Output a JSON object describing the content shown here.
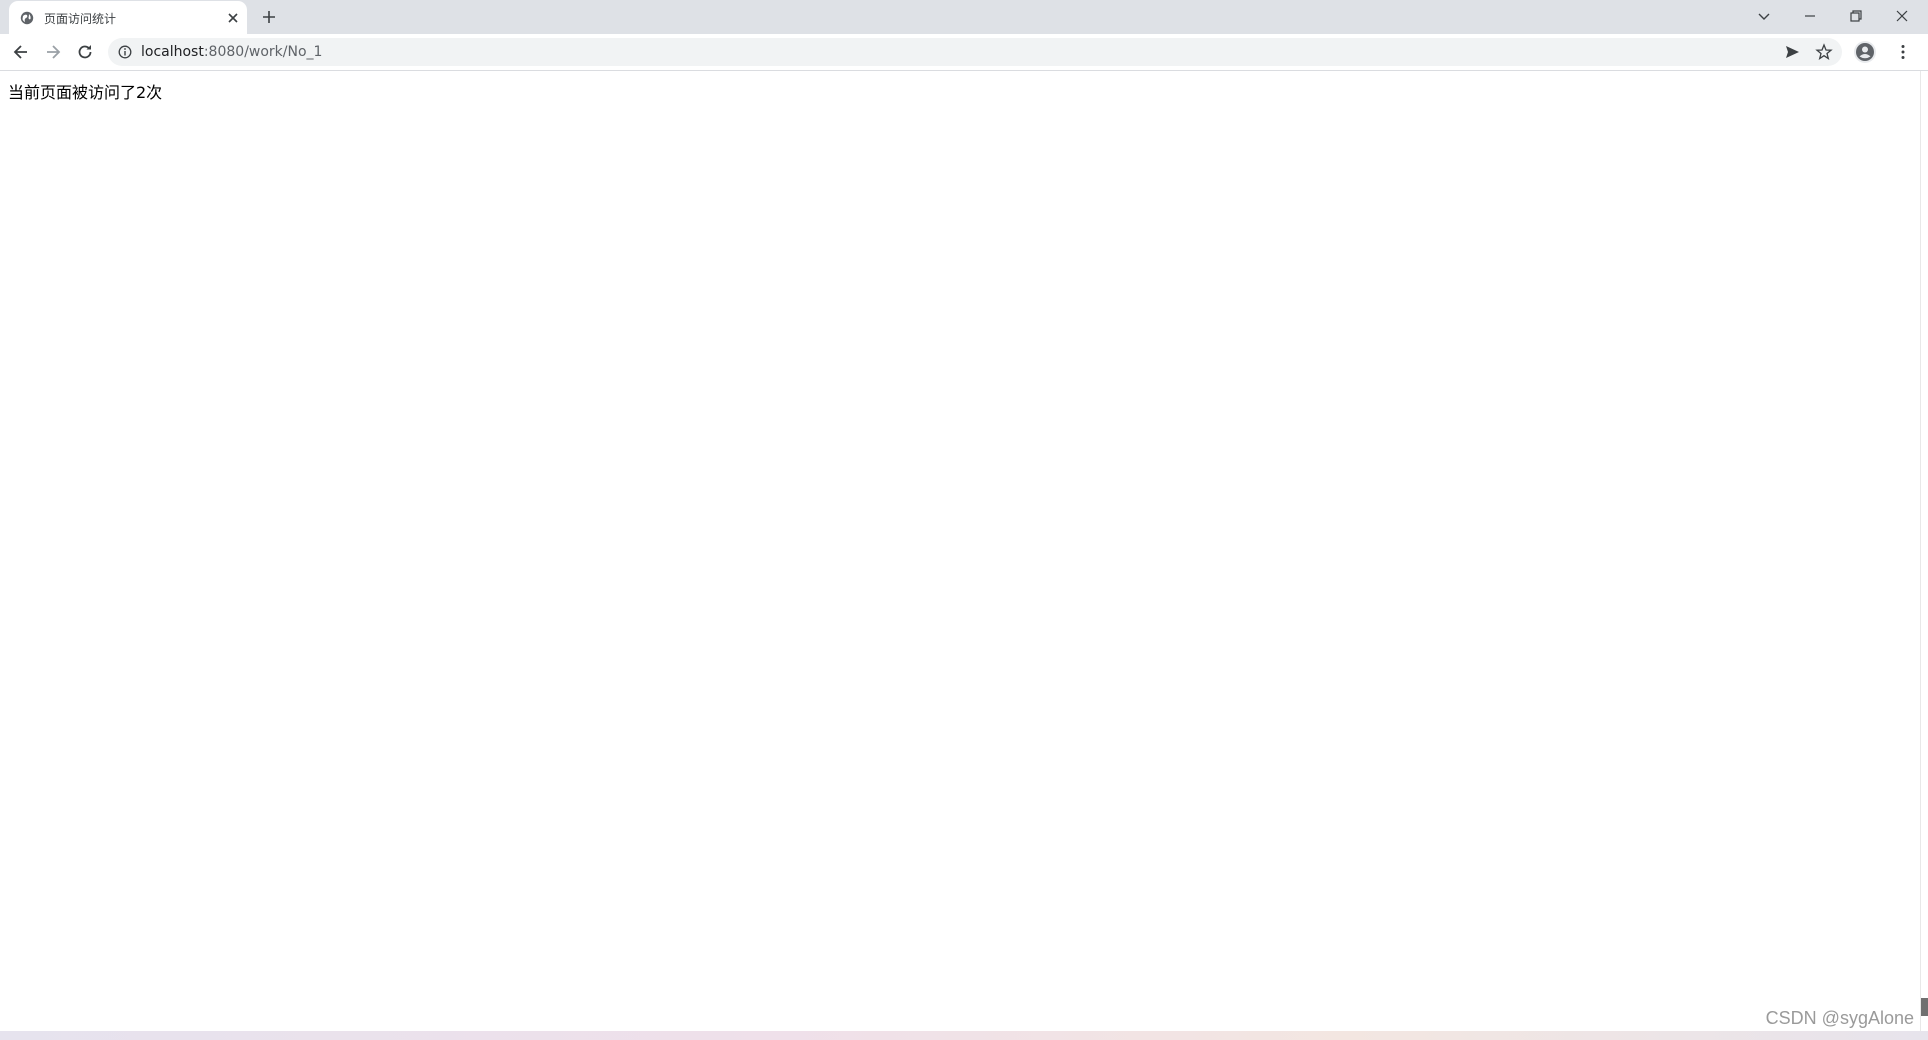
{
  "tab": {
    "title": "页面访问统计",
    "favicon": "globe-icon"
  },
  "address_bar": {
    "url_host": "localhost",
    "url_rest": ":8080/work/No_1"
  },
  "page": {
    "message": "当前页面被访问了2次"
  },
  "watermark": "CSDN @sygAlone",
  "colors": {
    "tabstrip": "#dee1e6",
    "omnibox": "#f1f3f4",
    "icon": "#5f6368"
  }
}
